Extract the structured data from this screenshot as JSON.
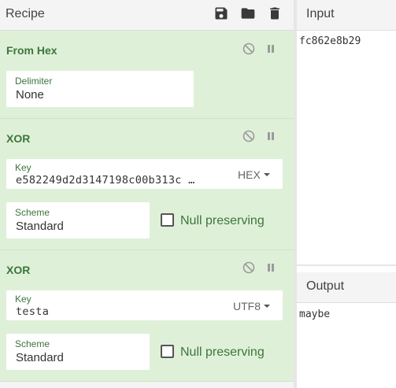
{
  "recipe": {
    "title": "Recipe",
    "icons": [
      "save-icon",
      "folder-icon",
      "trash-icon"
    ],
    "operations": [
      {
        "name": "From Hex",
        "fields": [
          {
            "label": "Delimiter",
            "value": "None"
          }
        ]
      },
      {
        "name": "XOR",
        "key": {
          "label": "Key",
          "value": "e582249d2d3147198c00b313c …",
          "format": "HEX"
        },
        "scheme": {
          "label": "Scheme",
          "value": "Standard"
        },
        "null_preserving": {
          "label": "Null preserving",
          "checked": false
        }
      },
      {
        "name": "XOR",
        "key": {
          "label": "Key",
          "value": "testa",
          "format": "UTF8"
        },
        "scheme": {
          "label": "Scheme",
          "value": "Standard"
        },
        "null_preserving": {
          "label": "Null preserving",
          "checked": false
        }
      }
    ]
  },
  "input": {
    "title": "Input",
    "value": "fc862e8b29"
  },
  "output": {
    "title": "Output",
    "value": "maybe"
  },
  "colors": {
    "op_background": "#dff0d8",
    "op_title": "#3c763d",
    "panel_background": "#f4f4f4"
  }
}
